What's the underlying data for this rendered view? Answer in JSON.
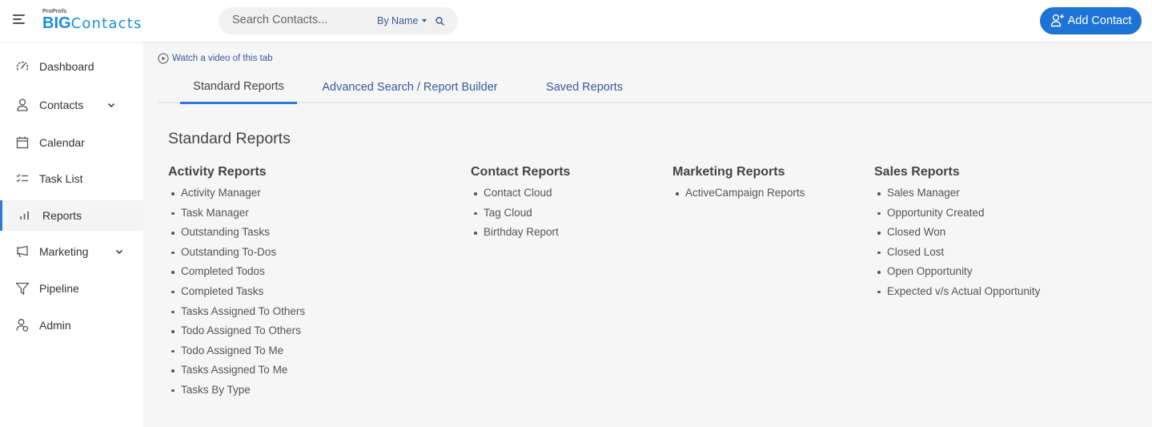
{
  "header": {
    "logo_small": "ProProfs",
    "logo_big_bold": "BIG",
    "logo_big_thin": "Contacts",
    "search_placeholder": "Search Contacts...",
    "search_value": "",
    "search_by": "By Name",
    "add_contact_label": "Add Contact",
    "accent_color": "#1e73d6"
  },
  "sidebar": {
    "items": [
      {
        "label": "Dashboard",
        "icon": "speedometer-icon",
        "has_chevron": false,
        "active": false
      },
      {
        "label": "Contacts",
        "icon": "user-icon",
        "has_chevron": true,
        "active": false
      },
      {
        "label": "Calendar",
        "icon": "calendar-icon",
        "has_chevron": false,
        "active": false
      },
      {
        "label": "Task List",
        "icon": "checklist-icon",
        "has_chevron": false,
        "active": false
      },
      {
        "label": "Reports",
        "icon": "bar-chart-icon",
        "has_chevron": false,
        "active": true
      },
      {
        "label": "Marketing",
        "icon": "megaphone-icon",
        "has_chevron": true,
        "active": false
      },
      {
        "label": "Pipeline",
        "icon": "funnel-icon",
        "has_chevron": false,
        "active": false
      },
      {
        "label": "Admin",
        "icon": "admin-user-icon",
        "has_chevron": false,
        "active": false
      }
    ]
  },
  "main": {
    "video_link": "Watch a video of this tab",
    "tabs": [
      {
        "label": "Standard Reports",
        "active": true
      },
      {
        "label": "Advanced Search / Report Builder",
        "active": false
      },
      {
        "label": "Saved Reports",
        "active": false
      }
    ],
    "page_title": "Standard Reports",
    "columns": [
      {
        "title": "Activity Reports",
        "items": [
          "Activity Manager",
          "Task Manager",
          "Outstanding Tasks",
          "Outstanding To-Dos",
          "Completed Todos",
          "Completed Tasks",
          "Tasks Assigned To Others",
          "Todo Assigned To Others",
          "Todo Assigned To Me",
          "Tasks Assigned To Me",
          "Tasks By Type"
        ]
      },
      {
        "title": "Contact Reports",
        "items": [
          "Contact Cloud",
          "Tag Cloud",
          "Birthday Report"
        ]
      },
      {
        "title": "Marketing Reports",
        "items": [
          "ActiveCampaign Reports"
        ]
      },
      {
        "title": "Sales Reports",
        "items": [
          "Sales Manager",
          "Opportunity Created",
          "Closed Won",
          "Closed Lost",
          "Open Opportunity",
          "Expected v/s Actual Opportunity"
        ]
      }
    ]
  }
}
